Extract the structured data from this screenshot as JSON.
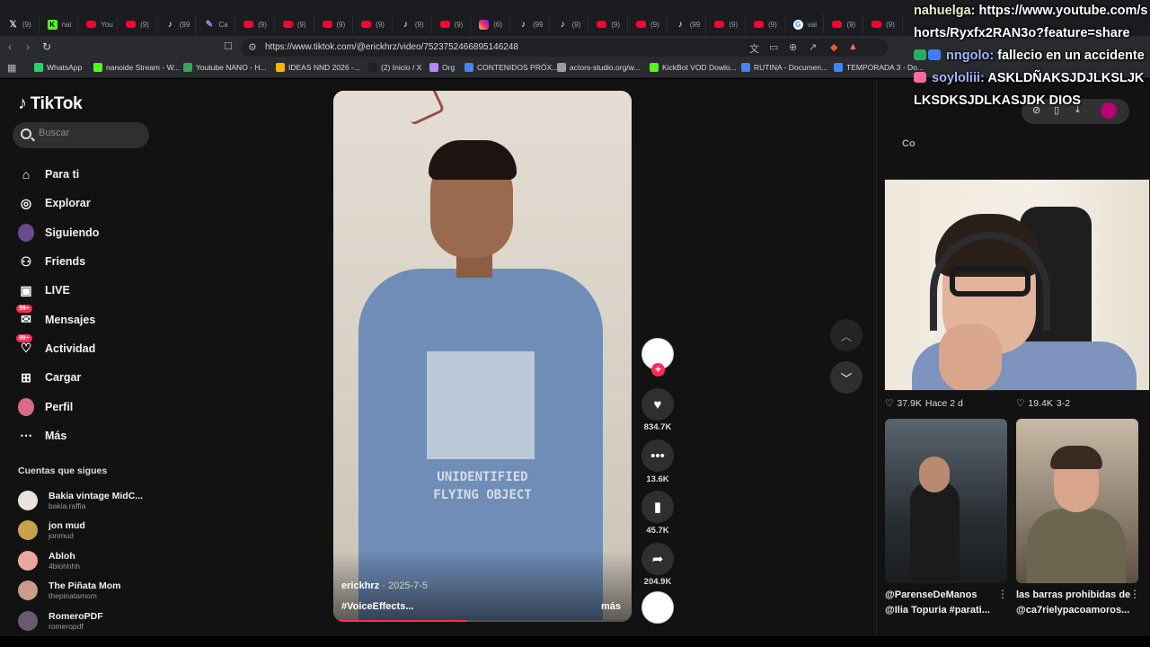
{
  "browser": {
    "tabs": [
      {
        "icon": "x",
        "label": "(9)"
      },
      {
        "icon": "kick",
        "label": "nai"
      },
      {
        "icon": "youtube",
        "label": "You"
      },
      {
        "icon": "youtube",
        "label": "(9)"
      },
      {
        "icon": "tiktok",
        "label": "(99"
      },
      {
        "icon": "feather",
        "label": "Ca"
      },
      {
        "icon": "youtube",
        "label": "(9)"
      },
      {
        "icon": "youtube",
        "label": "(9)"
      },
      {
        "icon": "youtube",
        "label": "(9)"
      },
      {
        "icon": "youtube",
        "label": "(9)"
      },
      {
        "icon": "tiktok",
        "label": "(9)"
      },
      {
        "icon": "youtube",
        "label": "(9)"
      },
      {
        "icon": "instagram",
        "label": "(6)"
      },
      {
        "icon": "tiktok",
        "label": "(99"
      },
      {
        "icon": "tiktok",
        "label": "(9)"
      },
      {
        "icon": "youtube",
        "label": "(9)"
      },
      {
        "icon": "youtube",
        "label": "(9)"
      },
      {
        "icon": "tiktok",
        "label": "(99"
      },
      {
        "icon": "youtube",
        "label": "(9)"
      },
      {
        "icon": "youtube",
        "label": "(9)"
      },
      {
        "icon": "google",
        "label": "vai"
      },
      {
        "icon": "youtube",
        "label": "(9)"
      },
      {
        "icon": "youtube",
        "label": "(9)"
      }
    ],
    "url": "https://www.tiktok.com/@erickhrz/video/7523752466895146248",
    "bookmarks": [
      {
        "label": "WhatsApp",
        "color": "#25d366"
      },
      {
        "label": "nanoide Stream - W...",
        "color": "#53fc18"
      },
      {
        "label": "Youtube NANO - H...",
        "color": "#34a853"
      },
      {
        "label": "IDEAS NND 2026 -...",
        "color": "#f4b400"
      },
      {
        "label": "(2) Inicio / X",
        "color": "#222222"
      },
      {
        "label": "Org",
        "color": "#b388ff"
      },
      {
        "label": "CONTENIDOS PRÓX...",
        "color": "#4285f4"
      },
      {
        "label": "actors-studio.org/w...",
        "color": "#9e9e9e"
      },
      {
        "label": "KickBot VOD Dowlo...",
        "color": "#53fc18"
      },
      {
        "label": "RUTINA - Documen...",
        "color": "#4285f4"
      },
      {
        "label": "TEMPORADA 3 - Do...",
        "color": "#4285f4"
      }
    ]
  },
  "tiktok": {
    "logo": "TikTok",
    "search_placeholder": "Buscar",
    "nav": [
      {
        "label": "Para ti",
        "icon": "home-icon",
        "glyph": "⌂"
      },
      {
        "label": "Explorar",
        "icon": "compass-icon",
        "glyph": "◎"
      },
      {
        "label": "Siguiendo",
        "icon": "avatar-icon",
        "glyph": ""
      },
      {
        "label": "Friends",
        "icon": "people-icon",
        "glyph": "⚇"
      },
      {
        "label": "LIVE",
        "icon": "live-icon",
        "glyph": "▣"
      },
      {
        "label": "Mensajes",
        "icon": "message-icon",
        "glyph": "✉",
        "badge": "99+"
      },
      {
        "label": "Actividad",
        "icon": "bell-icon",
        "glyph": "♡",
        "badge": "99+"
      },
      {
        "label": "Cargar",
        "icon": "upload-icon",
        "glyph": "⊞"
      },
      {
        "label": "Perfil",
        "icon": "profile-icon",
        "glyph": ""
      },
      {
        "label": "Más",
        "icon": "more-icon",
        "glyph": "⋯"
      }
    ],
    "following_title": "Cuentas que sigues",
    "following": [
      {
        "name": "Bakia vintage MidC...",
        "user": "bakia.raffia",
        "color": "#e8e2da"
      },
      {
        "name": "jon mud",
        "user": "jonmud",
        "color": "#c8a24a"
      },
      {
        "name": "Abloh",
        "user": "4blohhhh",
        "color": "#e8a7a0"
      },
      {
        "name": "The Piñata Mom",
        "user": "thepinatamom",
        "color": "#c99b8a"
      },
      {
        "name": "RomeroPDF",
        "user": "romeropdf",
        "color": "#6a5a70"
      }
    ],
    "video": {
      "username": "erickhrz",
      "date": "· 2025-7-5",
      "tags": "#VoiceEffects...",
      "more": "más",
      "shirt_text": "UNIDENTIFIED FLYING OBJECT",
      "progress": 0.45
    },
    "actions": {
      "likes": "834.7K",
      "comments": "13.6K",
      "saves": "45.7K",
      "shares": "204.9K"
    },
    "right_panel": {
      "tab_label": "Co",
      "items": [
        {
          "likes": "37.9K",
          "meta": "Hace 2 d",
          "caption_line1": "@ParenseDeManos",
          "caption_line2": "@Ilia Topuria #parati..."
        },
        {
          "likes": "19.4K",
          "meta": "3-2",
          "caption_line1": "las barras prohibidas de",
          "caption_line2": "@ca7rielypacoamoros..."
        }
      ]
    }
  },
  "overlay": {
    "chat": [
      {
        "name": "nahuelga:",
        "text": "https://www.youtube.com/shorts/Ryxfx2RAN3o?feature=share"
      },
      {
        "name": "nngolo:",
        "text": "fallecio en un accidente"
      },
      {
        "name": "soyloliii:",
        "text": "ASKLDÑAKSJDJLKSLJKLKSDKSJDLKASJDK DIOS"
      }
    ]
  }
}
